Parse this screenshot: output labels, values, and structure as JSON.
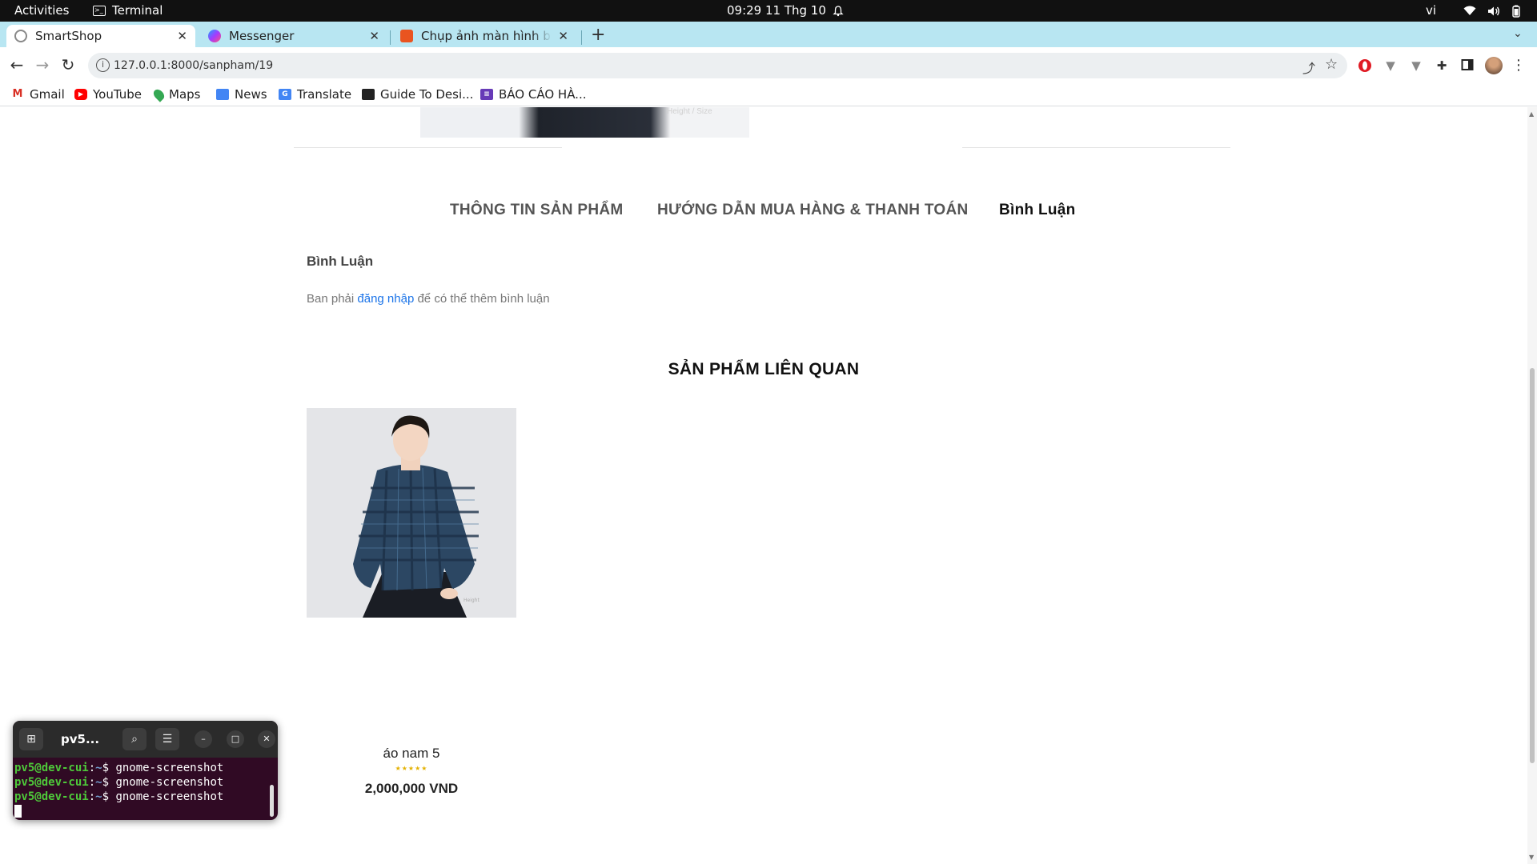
{
  "os_topbar": {
    "activities": "Activities",
    "app_name": "Terminal",
    "clock": "09:29  11 Thg 10",
    "language": "vi"
  },
  "browser": {
    "tabs": [
      {
        "title": "SmartShop",
        "active": true
      },
      {
        "title": "Messenger",
        "active": false
      },
      {
        "title": "Chụp ảnh màn hình bằn",
        "active": false
      }
    ],
    "url": "127.0.0.1:8000/sanpham/19",
    "bookmarks": [
      "Gmail",
      "YouTube",
      "Maps",
      "News",
      "Translate",
      "Guide To Desi...",
      "BÁO CÁO HÀ..."
    ]
  },
  "page": {
    "top_image_caption": "Height / Size",
    "tabs": [
      "THÔNG TIN SẢN PHẨM",
      "HƯỚNG DẪN MUA HÀNG & THANH TOÁN",
      "Bình Luận"
    ],
    "comment_heading": "Bình Luận",
    "comment_note": {
      "before": "Ban phải ",
      "link": "đăng nhập",
      "after": " để có thể thêm bình luận"
    },
    "related_title": "SẢN PHẨM LIÊN QUAN",
    "related_products": [
      {
        "name": "áo nam 5",
        "stars": "★★★★★",
        "rating": 5,
        "price": "2,000,000 VND"
      }
    ]
  },
  "terminal": {
    "title": "pv5...",
    "prompt_user": "pv5@dev-cui",
    "prompt_path": "~",
    "lines": [
      "gnome-screenshot",
      "gnome-screenshot",
      "gnome-screenshot"
    ]
  },
  "colors": {
    "tabstrip": "#b8e6f2",
    "link": "#1a73e8",
    "terminal_bg": "#300a24",
    "star": "#e3b100"
  },
  "icons": [
    "terminal-icon",
    "bell-icon",
    "wifi-icon",
    "volume-icon",
    "battery-icon",
    "back-icon",
    "forward-icon",
    "reload-icon",
    "share-icon",
    "star-icon",
    "extensions-icon",
    "profile-icon",
    "menu-icon"
  ]
}
